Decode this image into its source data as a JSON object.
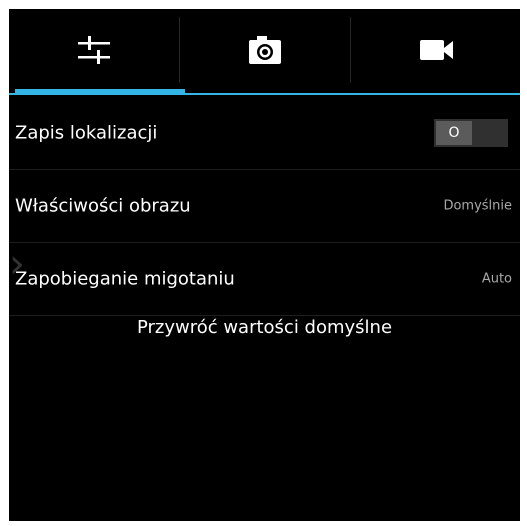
{
  "tabs": [
    {
      "icon": "sliders-icon",
      "active": true
    },
    {
      "icon": "camera-icon",
      "active": false
    },
    {
      "icon": "video-camera-icon",
      "active": false
    }
  ],
  "colors": {
    "accent": "#33B5E5",
    "background": "#000000",
    "text": "#FFFFFF",
    "secondary_text": "#A8A8A8"
  },
  "settings": {
    "location": {
      "label": "Zapis lokalizacji",
      "toggle_state": "O"
    },
    "picture_properties": {
      "label": "Właściwości obrazu",
      "value": "Domyślnie"
    },
    "anti_flicker": {
      "label": "Zapobieganie migotaniu",
      "value": "Auto"
    }
  },
  "restore_label": "Przywróć wartości domyślne"
}
